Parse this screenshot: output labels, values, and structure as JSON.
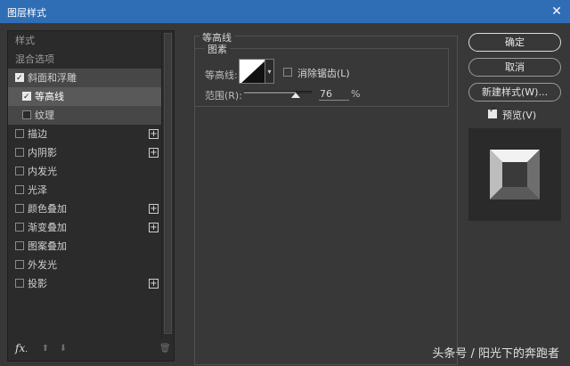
{
  "window": {
    "title": "图层样式",
    "close_label": "✕"
  },
  "left_panel": {
    "items": [
      {
        "label": "样式",
        "type": "header"
      },
      {
        "label": "混合选项",
        "type": "header"
      },
      {
        "label": "斜面和浮雕",
        "checked": true,
        "level": 0,
        "plus": false,
        "highlight": true
      },
      {
        "label": "等高线",
        "checked": true,
        "level": 1,
        "plus": false,
        "selected": true
      },
      {
        "label": "纹理",
        "checked": false,
        "level": 1,
        "plus": false,
        "highlight": true
      },
      {
        "label": "描边",
        "checked": false,
        "level": 0,
        "plus": true
      },
      {
        "label": "内阴影",
        "checked": false,
        "level": 0,
        "plus": true
      },
      {
        "label": "内发光",
        "checked": false,
        "level": 0,
        "plus": false
      },
      {
        "label": "光泽",
        "checked": false,
        "level": 0,
        "plus": false
      },
      {
        "label": "颜色叠加",
        "checked": false,
        "level": 0,
        "plus": true
      },
      {
        "label": "渐变叠加",
        "checked": false,
        "level": 0,
        "plus": true
      },
      {
        "label": "图案叠加",
        "checked": false,
        "level": 0,
        "plus": false
      },
      {
        "label": "外发光",
        "checked": false,
        "level": 0,
        "plus": false
      },
      {
        "label": "投影",
        "checked": false,
        "level": 0,
        "plus": true
      }
    ],
    "plus_glyph": "+",
    "fx_label": "fx",
    "fx_sub": ".",
    "up_glyph": "⬆",
    "down_glyph": "⬇",
    "trash_glyph": "🗑"
  },
  "contour": {
    "group_title": "等高线",
    "sub_title": "图素",
    "contour_label": "等高线:",
    "dropdown_glyph": "▾",
    "anti_alias_label": "消除锯齿(L)",
    "anti_alias_checked": false,
    "range_label": "范围(R):",
    "range_value": "76",
    "range_percent": 76,
    "range_unit": "%"
  },
  "buttons": {
    "ok": "确定",
    "cancel": "取消",
    "new_style": "新建样式(W)..."
  },
  "preview": {
    "label": "预览(V)",
    "checked": true
  },
  "watermark": "头条号 / 阳光下的奔跑者",
  "colors": {
    "titlebar": "#2f6db5",
    "dialog": "#383838",
    "panel": "#2b2b2b",
    "selected": "#595959"
  }
}
